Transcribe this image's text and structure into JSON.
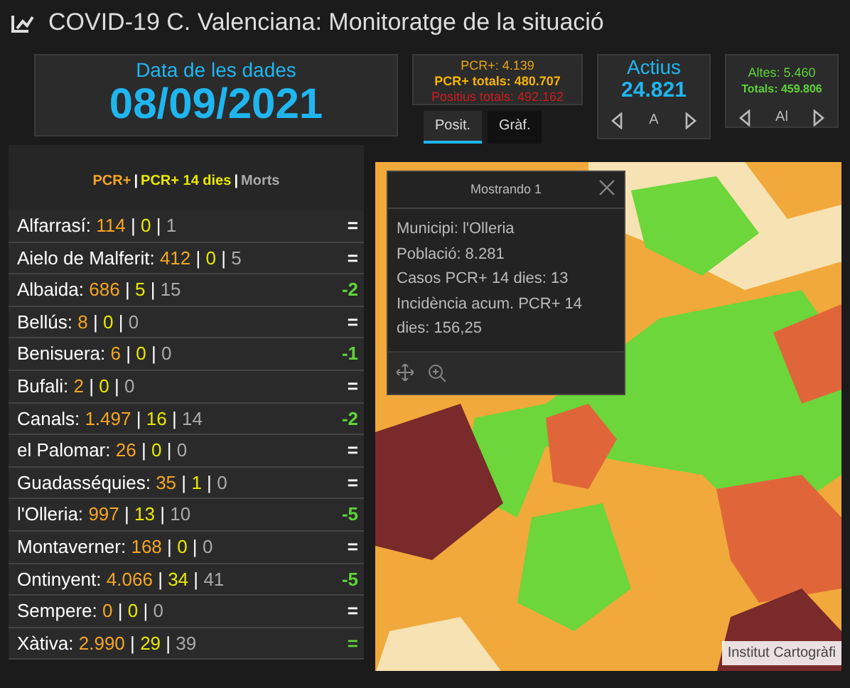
{
  "window": {
    "title": "COVID-19 C. Valenciana: Monitoratge de la situació"
  },
  "date_card": {
    "label": "Data de les dades",
    "value": "08/09/2021"
  },
  "positives_card": {
    "lines": [
      {
        "text": "PCR+: 4.139",
        "color": "#e8a317"
      },
      {
        "text": "PCR+ totals: 480.707",
        "color": "#f5b400"
      },
      {
        "text": "Positius totals: 492.162",
        "color": "#d01c1c"
      }
    ]
  },
  "tabs": [
    {
      "label": "Posit.",
      "selected": true
    },
    {
      "label": "Gràf.",
      "selected": false
    }
  ],
  "actius_card": {
    "label": "Actius",
    "value": "24.821",
    "pager": "A"
  },
  "altes_card": {
    "lines": [
      {
        "text": "Altes: 5.460"
      },
      {
        "text": "Totals: 459.806"
      }
    ],
    "pager": "Al"
  },
  "legend": [
    {
      "text": "PCR+",
      "color": "#f5a623"
    },
    {
      "text": "|",
      "color": "#ffffff"
    },
    {
      "text": "PCR+ 14 dies",
      "color": "#e8e800"
    },
    {
      "text": "|",
      "color": "#ffffff"
    },
    {
      "text": "Morts",
      "color": "#aaaaaa"
    }
  ],
  "municipalities": [
    {
      "name": "Alfarrasí:",
      "pcr": "114",
      "sep1": "|",
      "pcr14": "0",
      "sep2": "|",
      "deaths": "1",
      "trend": {
        "text": "=",
        "color": "#ffffff"
      }
    },
    {
      "name": "Aielo de Malferit:",
      "pcr": "412",
      "sep1": "|",
      "pcr14": "0",
      "sep2": "|",
      "deaths": "5",
      "trend": {
        "text": "=",
        "color": "#ffffff"
      }
    },
    {
      "name": "Albaida:",
      "pcr": "686",
      "sep1": "|",
      "pcr14": "5",
      "sep2": "|",
      "deaths": "15",
      "trend": {
        "text": "-2",
        "color": "#5fd33a"
      }
    },
    {
      "name": "Bellús:",
      "pcr": "8",
      "sep1": "|",
      "pcr14": "0",
      "sep2": "|",
      "deaths": "0",
      "trend": {
        "text": "=",
        "color": "#ffffff"
      }
    },
    {
      "name": "Benisuera:",
      "pcr": "6",
      "sep1": "|",
      "pcr14": "0",
      "sep2": "|",
      "deaths": "0",
      "trend": {
        "text": "-1",
        "color": "#5fd33a"
      }
    },
    {
      "name": "Bufali:",
      "pcr": "2",
      "sep1": "|",
      "pcr14": "0",
      "sep2": "|",
      "deaths": "0",
      "trend": {
        "text": "=",
        "color": "#ffffff"
      }
    },
    {
      "name": "Canals:",
      "pcr": "1.497",
      "sep1": "|",
      "pcr14": "16",
      "sep2": "|",
      "deaths": "14",
      "trend": {
        "text": "-2",
        "color": "#5fd33a"
      }
    },
    {
      "name": "el Palomar:",
      "pcr": "26",
      "sep1": "|",
      "pcr14": "0",
      "sep2": "|",
      "deaths": "0",
      "trend": {
        "text": "=",
        "color": "#ffffff"
      }
    },
    {
      "name": "Guadasséquies:",
      "pcr": "35",
      "sep1": "|",
      "pcr14": "1",
      "sep2": "|",
      "deaths": "0",
      "trend": {
        "text": "=",
        "color": "#ffffff"
      }
    },
    {
      "name": "l'Olleria:",
      "pcr": "997",
      "sep1": "|",
      "pcr14": "13",
      "sep2": "|",
      "deaths": "10",
      "trend": {
        "text": "-5",
        "color": "#5fd33a"
      }
    },
    {
      "name": "Montaverner:",
      "pcr": "168",
      "sep1": "|",
      "pcr14": "0",
      "sep2": "|",
      "deaths": "0",
      "trend": {
        "text": "=",
        "color": "#ffffff"
      }
    },
    {
      "name": "Ontinyent:",
      "pcr": "4.066",
      "sep1": "|",
      "pcr14": "34",
      "sep2": "|",
      "deaths": "41",
      "trend": {
        "text": "-5",
        "color": "#5fd33a"
      }
    },
    {
      "name": "Sempere:",
      "pcr": "0",
      "sep1": "|",
      "pcr14": "0",
      "sep2": "|",
      "deaths": "0",
      "trend": {
        "text": "=",
        "color": "#ffffff"
      }
    },
    {
      "name": "Xàtiva:",
      "pcr": "2.990",
      "sep1": "|",
      "pcr14": "29",
      "sep2": "|",
      "deaths": "39",
      "trend": {
        "text": "=",
        "color": "#5fd33a"
      }
    }
  ],
  "map": {
    "kind": "picture",
    "popup": {
      "title": "Mostrando 1",
      "lines": [
        "Municipi: l'Olleria",
        "Població: 8.281",
        "Casos PCR+ 14 dies: 13",
        "Incidència acum. PCR+ 14 dies: 156,25"
      ]
    },
    "attribution": "Institut Cartogràfi"
  }
}
